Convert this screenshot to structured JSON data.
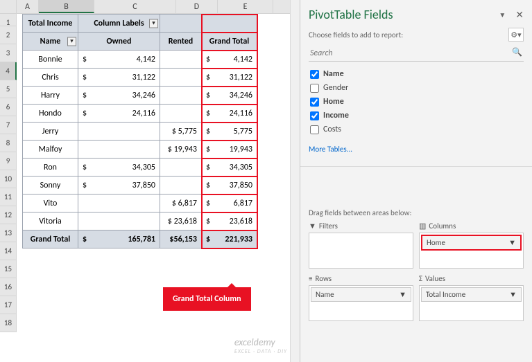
{
  "columns": [
    "A",
    "B",
    "C",
    "D",
    "E"
  ],
  "pane": {
    "title": "PivotTable Fields",
    "subtitle": "Choose fields to add to report:",
    "search_placeholder": "Search",
    "more": "More Tables...",
    "drag_label": "Drag fields between areas below:",
    "fields": [
      {
        "label": "Name",
        "checked": true
      },
      {
        "label": "Gender",
        "checked": false
      },
      {
        "label": "Home",
        "checked": true
      },
      {
        "label": "Income",
        "checked": true
      },
      {
        "label": "Costs",
        "checked": false
      }
    ],
    "areas": {
      "filters": {
        "title": "Filters",
        "items": []
      },
      "columns": {
        "title": "Columns",
        "items": [
          "Home"
        ]
      },
      "rows": {
        "title": "Rows",
        "items": [
          "Name"
        ]
      },
      "values": {
        "title": "Values",
        "items": [
          "Total Income"
        ]
      }
    }
  },
  "pivot": {
    "corner": "Total Income",
    "col_labels": "Column Labels",
    "name_h": "Name",
    "owned_h": "Owned",
    "rented_h": "Rented",
    "gt_h": "Grand Total",
    "gt_row": "Grand Total",
    "rows": [
      {
        "name": "Bonnie",
        "owned": "4,142",
        "rented": "",
        "gt": "4,142"
      },
      {
        "name": "Chris",
        "owned": "31,122",
        "rented": "",
        "gt": "31,122"
      },
      {
        "name": "Harry",
        "owned": "34,246",
        "rented": "",
        "gt": "34,246"
      },
      {
        "name": "Hondo",
        "owned": "24,116",
        "rented": "",
        "gt": "24,116"
      },
      {
        "name": "Jerry",
        "owned": "",
        "rented": "$  5,775",
        "gt": "5,775"
      },
      {
        "name": "Malfoy",
        "owned": "",
        "rented": "$ 19,943",
        "gt": "19,943"
      },
      {
        "name": "Ron",
        "owned": "34,305",
        "rented": "",
        "gt": "34,305"
      },
      {
        "name": "Sonny",
        "owned": "37,850",
        "rented": "",
        "gt": "37,850"
      },
      {
        "name": "Vito",
        "owned": "",
        "rented": "$  6,817",
        "gt": "6,817"
      },
      {
        "name": "Vitoria",
        "owned": "",
        "rented": "$ 23,618",
        "gt": "23,618"
      }
    ],
    "totals": {
      "owned": "165,781",
      "rented": "$56,153",
      "gt": "221,933"
    }
  },
  "callout": "Grand Total Column",
  "watermark": {
    "main": "exceldemy",
    "sub": "EXCEL · DATA · DIY"
  },
  "chart_data": {
    "type": "table",
    "title": "Total Income",
    "columns": [
      "Name",
      "Owned",
      "Rented",
      "Grand Total"
    ],
    "rows": [
      [
        "Bonnie",
        4142,
        null,
        4142
      ],
      [
        "Chris",
        31122,
        null,
        31122
      ],
      [
        "Harry",
        34246,
        null,
        34246
      ],
      [
        "Hondo",
        24116,
        null,
        24116
      ],
      [
        "Jerry",
        null,
        5775,
        5775
      ],
      [
        "Malfoy",
        null,
        19943,
        19943
      ],
      [
        "Ron",
        34305,
        null,
        34305
      ],
      [
        "Sonny",
        37850,
        null,
        37850
      ],
      [
        "Vito",
        null,
        6817,
        6817
      ],
      [
        "Vitoria",
        null,
        23618,
        23618
      ]
    ],
    "totals": [
      "Grand Total",
      165781,
      56153,
      221933
    ]
  }
}
